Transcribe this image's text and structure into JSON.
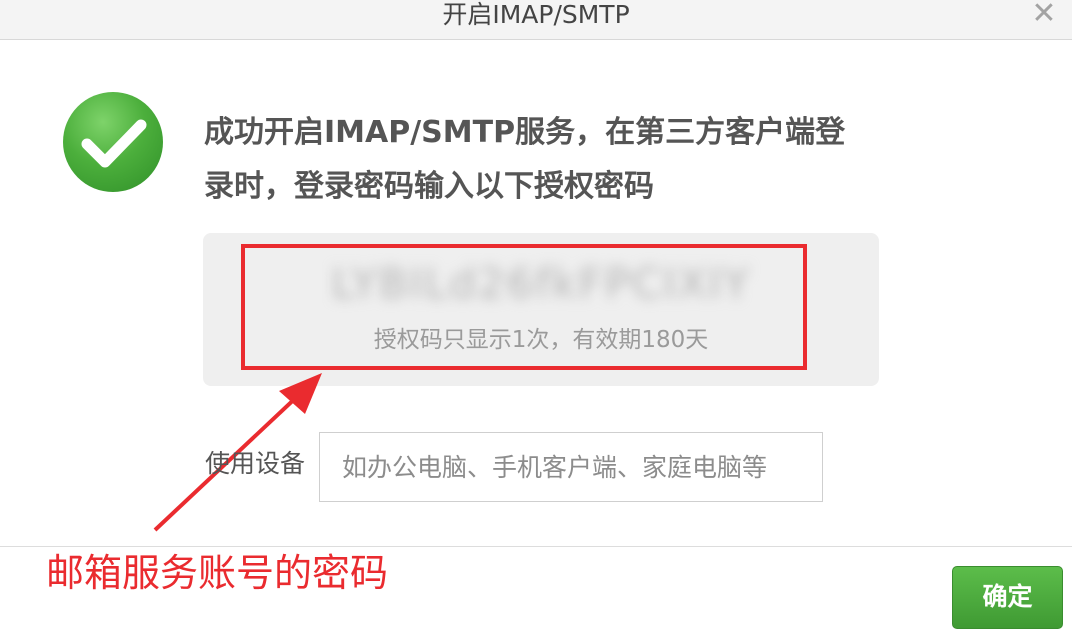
{
  "dialog": {
    "title": "开启IMAP/SMTP",
    "close_symbol": "✕"
  },
  "status": {
    "icon": "check-circle-icon",
    "color": "#4caf3c",
    "message_line1": "成功开启IMAP/SMTP服务，在第三方客户端登",
    "message_line2": "录时，登录密码输入以下授权密码"
  },
  "auth_code": {
    "value": "LYBILd26fkFPCIXIY",
    "note": "授权码只显示1次，有效期180天"
  },
  "device": {
    "label": "使用设备",
    "placeholder": "如办公电脑、手机客户端、家庭电脑等",
    "value": ""
  },
  "annotation": {
    "text": "邮箱服务账号的密码",
    "color": "#ea2b2f"
  },
  "footer": {
    "confirm_label": "确定",
    "confirm_color": "#4caf3c"
  }
}
